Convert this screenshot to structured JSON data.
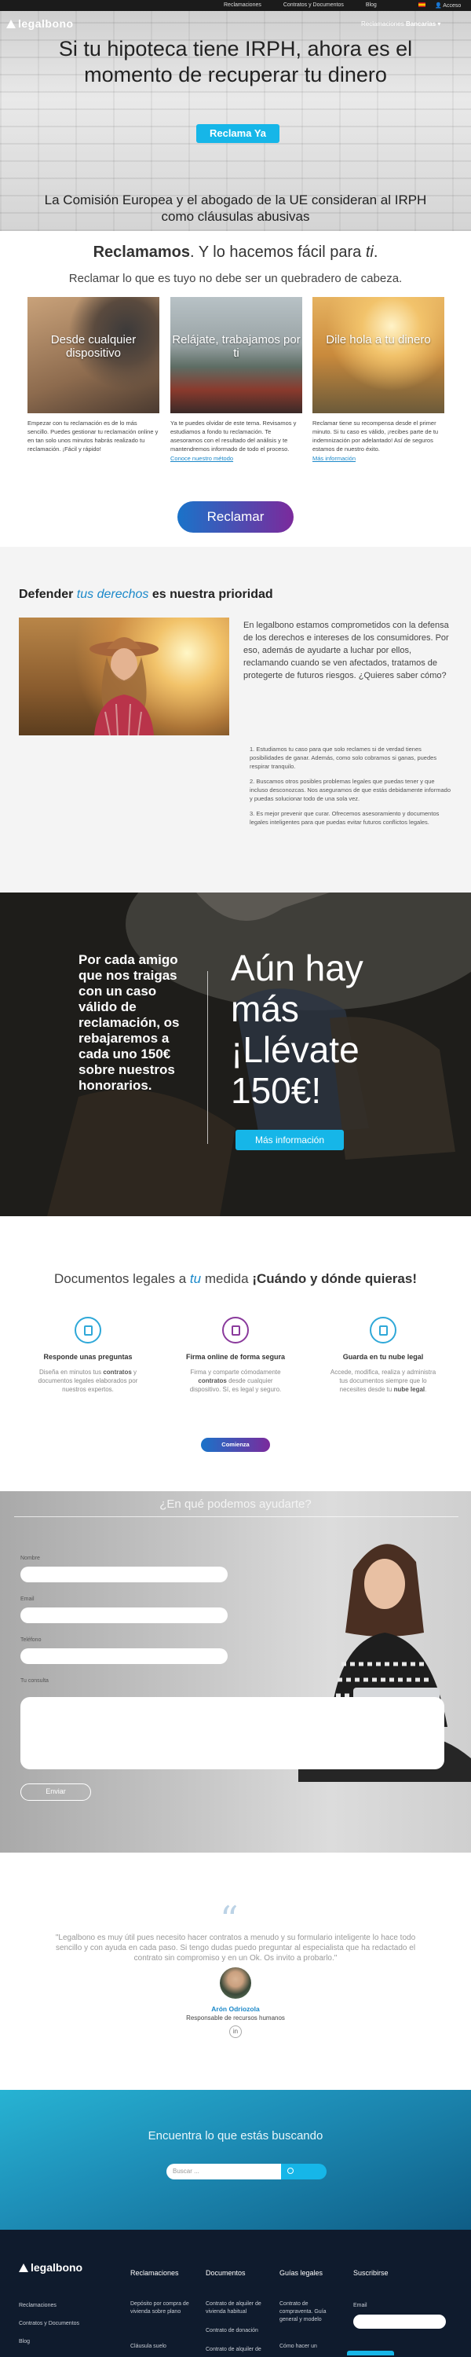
{
  "topbar": {
    "links": [
      "Reclamaciones",
      "Contratos y Documentos",
      "Blog"
    ],
    "account_label": "Acceso"
  },
  "header": {
    "logo": "legalbono",
    "nav_prefix": "Reclamaciones",
    "nav_bold": "Bancarias"
  },
  "hero": {
    "title": "Si tu hipoteca tiene IRPH, ahora es el momento de recuperar tu dinero",
    "cta": "Reclama Ya",
    "subtitle": "La Comisión Europea y el abogado de la UE consideran al IRPH como cláusulas abusivas"
  },
  "reclamamos": {
    "title_bold": "Reclamamos",
    "title_rest": ". Y lo hacemos fácil para ",
    "title_em": "ti",
    "title_end": ".",
    "subtitle": "Reclamar lo que es tuyo no debe ser un quebradero de cabeza.",
    "cards": [
      {
        "label": "Desde cualquier dispositivo",
        "text": "Empezar con tu reclamación es de lo más sencillo. Puedes gestionar tu reclamación online y en tan solo unos minutos habrás realizado tu reclamación. ¡Fácil y rápido!",
        "link": ""
      },
      {
        "label": "Relájate, trabajamos por ti",
        "text": "Ya te puedes olvidar de este tema. Revisamos y estudiamos a fondo tu reclamación. Te asesoramos con el resultado del análisis y te mantendremos informado de todo el proceso.",
        "link": "Conoce nuestro método"
      },
      {
        "label": "Dile hola a tu dinero",
        "text": "Reclamar tiene su recompensa desde el primer minuto. Si tu caso es válido, ¡recibes parte de tu indemnización por adelantado! Así de seguros estamos de nuestro éxito.",
        "link": "Más información"
      }
    ],
    "cta": "Reclamar"
  },
  "defender": {
    "title_pre": "Defender ",
    "title_em": "tus derechos",
    "title_post": " es nuestra prioridad",
    "paragraph": "En legalbono estamos comprometidos con la defensa de los derechos e intereses de los consumidores. Por eso, además de ayudarte a luchar por ellos, reclamando cuando se ven afectados, tratamos de protegerte de futuros riesgos. ¿Quieres saber cómo?",
    "list": [
      "1. Estudiamos tu caso para que solo reclames si de verdad tienes posibilidades de ganar. Además, como solo cobramos si ganas, puedes respirar tranquilo.",
      "2. Buscamos otros posibles problemas legales que puedas tener y que incluso desconozcas. Nos aseguramos de que estás debidamente informado y puedas solucionar todo de una sola vez.",
      "3. Es mejor prevenir que curar. Ofrecemos asesoramiento y documentos legales inteligentes para que puedas evitar futuros conflictos legales."
    ]
  },
  "promo": {
    "left_text": "Por cada amigo que nos traigas con un caso válido de reclamación, os rebajaremos a cada uno 150€ sobre nuestros honorarios.",
    "right_text": "Aún hay más ¡Llévate 150€!",
    "cta": "Más información"
  },
  "documentos": {
    "title_pre": "Documentos legales a ",
    "title_em": "tu",
    "title_mid": " medida ",
    "title_bold": "¡Cuándo y dónde quieras!",
    "features": [
      {
        "icon": "document-icon",
        "title": "Responde unas preguntas",
        "text_pre": "Diseña en minutos tus ",
        "text_bold": "contratos",
        "text_post": " y documentos legales elaborados por nuestros expertos.",
        "color": "#2fa8d8"
      },
      {
        "icon": "signature-icon",
        "title": "Firma online de forma segura",
        "text_pre": "Firma y comparte cómodamente ",
        "text_bold": "contratos",
        "text_post": " desde cualquier dispositivo. Sí, es legal y seguro.",
        "color": "#8a3a9c"
      },
      {
        "icon": "cloud-icon",
        "title": "Guarda en tu nube legal",
        "text_pre": "Accede, modifica, realiza y administra tus documentos siempre que lo necesites desde tu ",
        "text_bold": "nube legal",
        "text_post": ".",
        "color": "#2fa8d8"
      }
    ],
    "cta": "Comienza"
  },
  "contact": {
    "title": "¿En qué podemos ayudarte?",
    "fields": [
      {
        "label": "Nombre"
      },
      {
        "label": "Email"
      },
      {
        "label": "Teléfono"
      },
      {
        "label": "Tu consulta"
      }
    ],
    "send": "Enviar"
  },
  "testimonial": {
    "quote": "\"Legalbono es muy útil pues necesito hacer contratos a menudo y su formulario inteligente lo hace todo sencillo y con ayuda en cada paso. Si tengo dudas puedo preguntar al especialista que ha redactado el contrato sin compromiso y en un Ok. Os invito a probarlo.\"",
    "name": "Arón Odriozola",
    "role": "Responsable de recursos humanos",
    "social": "in"
  },
  "search": {
    "title": "Encuentra lo que estás buscando",
    "placeholder": "Buscar ..."
  },
  "footer": {
    "logo": "legalbono",
    "columns": [
      {
        "heading": "Reclamaciones",
        "links": []
      },
      {
        "heading": "Documentos",
        "links": [
          "Depósito por compra de vivienda sobre plano",
          "Cláusula suelo"
        ]
      },
      {
        "heading": "Guías legales",
        "links": [
          "Contrato de alquiler de vivienda habitual",
          "Contrato de donación",
          "Contrato de alquiler de"
        ]
      },
      {
        "heading": "Suscribirse",
        "links": [
          "Contrato de compraventa. Guía general y modelo",
          "Cómo hacer un"
        ]
      }
    ],
    "side_links": [
      "Reclamaciones",
      "Contratos y Documentos",
      "Blog"
    ],
    "email_label": "Email"
  },
  "colors": {
    "accent": "#16b6e8",
    "link": "#1a88c9",
    "dark": "#0f1b2d"
  }
}
